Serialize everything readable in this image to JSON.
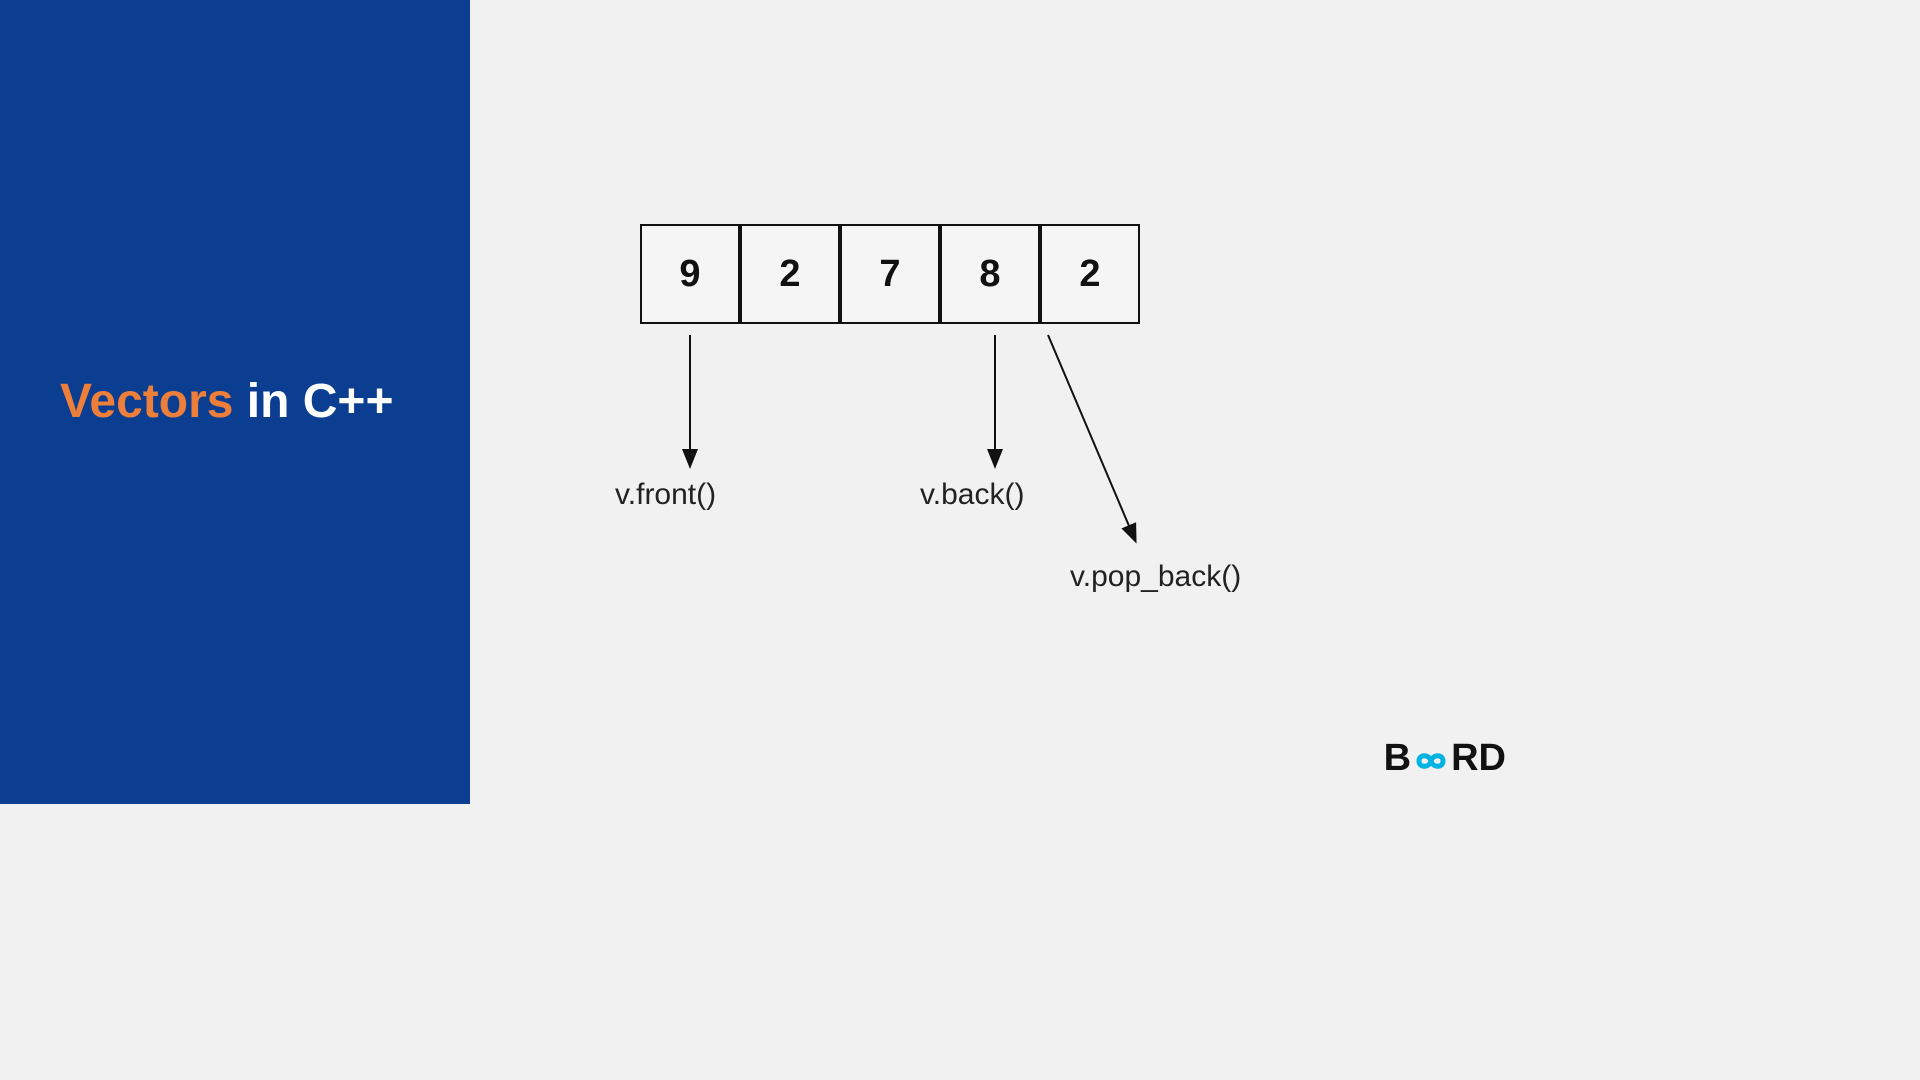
{
  "title": {
    "accent": "Vectors",
    "rest": " in C++"
  },
  "vector": {
    "cells": [
      "9",
      "2",
      "7",
      "8",
      "2"
    ]
  },
  "labels": {
    "front": "v.front()",
    "back": "v.back()",
    "pop_back": "v.pop_back()"
  },
  "logo": {
    "b": "B",
    "rd": "RD"
  },
  "colors": {
    "panel_blue": "#0b3d91",
    "accent_orange": "#ee7f3b",
    "background": "#f1f1f1",
    "infinity": "#00b3e3",
    "text_dark": "#111111"
  }
}
